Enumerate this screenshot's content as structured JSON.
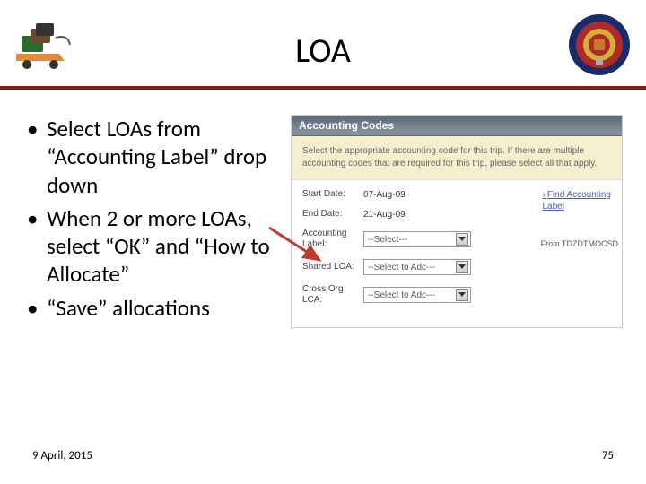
{
  "header": {
    "title": "LOA"
  },
  "bullets": [
    "Select LOAs from “Accounting Label” drop down",
    "When 2 or more LOAs, select “OK” and “How to Allocate”",
    "“Save” allocations"
  ],
  "panel": {
    "header": "Accounting Codes",
    "note": "Select the appropriate accounting code for this trip. If there are multiple accounting codes that are required for this trip, please select all that apply.",
    "start_date_label": "Start Date:",
    "start_date_value": "07-Aug-09",
    "end_date_label": "End Date:",
    "end_date_value": "21-Aug-09",
    "find_link_line1": "Find Accounting",
    "find_link_line2": "Label",
    "accounting_label": "Accounting Label:",
    "accounting_select": "--Select---",
    "from_label": "From",
    "from_value": "TDZDTMOCSD",
    "shared_loa_label": "Shared LOA:",
    "shared_loa_select": "--Select to Adc---",
    "cross_org_label": "Cross Org LCA:",
    "cross_org_select": "--Select to Adc---"
  },
  "footer": {
    "date": "9 April, 2015",
    "page": "75"
  }
}
